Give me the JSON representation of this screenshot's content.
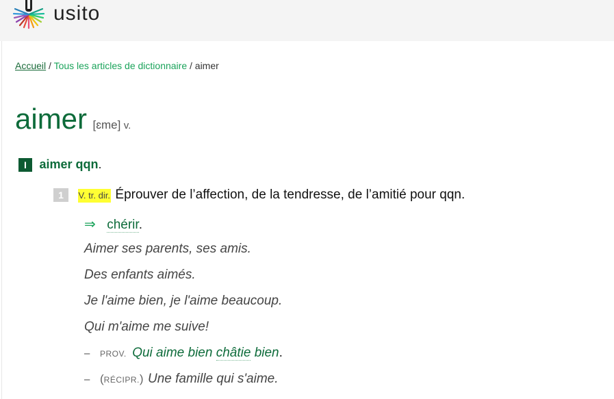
{
  "header": {
    "logo_text": "usito"
  },
  "breadcrumb": {
    "home": "Accueil",
    "sep1": "/",
    "articles": "Tous les articles de dictionnaire",
    "sep2": "/",
    "current": "aimer"
  },
  "entry": {
    "headword": "aimer",
    "phonetic": "[ɛme]",
    "pos": "v."
  },
  "sense_I": {
    "number": "I",
    "label": "aimer qqn",
    "punct": "."
  },
  "sense_1": {
    "number": "1",
    "grammar": "V. tr. dir.",
    "definition": "Éprouver de l’affection, de la tendresse, de l’amitié pour qqn."
  },
  "synonym": {
    "arrow": "⇒",
    "word": "chérir",
    "punct": "."
  },
  "examples": [
    "Aimer ses parents, ses amis.",
    "Des enfants aimés.",
    "Je l'aime bien, je l'aime beaucoup.",
    "Qui m'aime me suive!"
  ],
  "proverb": {
    "dash": "–",
    "label": "PROV.",
    "text_a": "Qui aime bien ",
    "text_b": "châtie",
    "text_c": " bien",
    "punct": "."
  },
  "reciprocal": {
    "dash": "–",
    "open": "(",
    "label": "RÉCIPR.",
    "close": ")",
    "text": "Une famille qui s'aime."
  },
  "colors": {
    "accent": "#0d6b3a",
    "link": "#1aa35a",
    "highlight": "#ffff33"
  }
}
